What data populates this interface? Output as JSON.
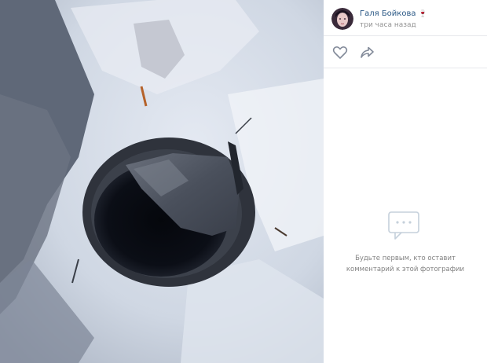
{
  "post": {
    "author_name": "Галя Бойкова",
    "author_badge_icon": "wine-glass-icon",
    "timestamp": "три часа назад"
  },
  "actions": {
    "like_icon": "heart-icon",
    "share_icon": "share-arrow-icon"
  },
  "comments": {
    "empty_icon": "comments-icon",
    "empty_text": "Будьте первым, кто оставит комментарий к этой фотографии"
  },
  "photo": {
    "subject": "broken manhole cover in snow"
  },
  "colors": {
    "link": "#2a5885",
    "muted": "#939393",
    "divider": "#e7e8ec"
  }
}
